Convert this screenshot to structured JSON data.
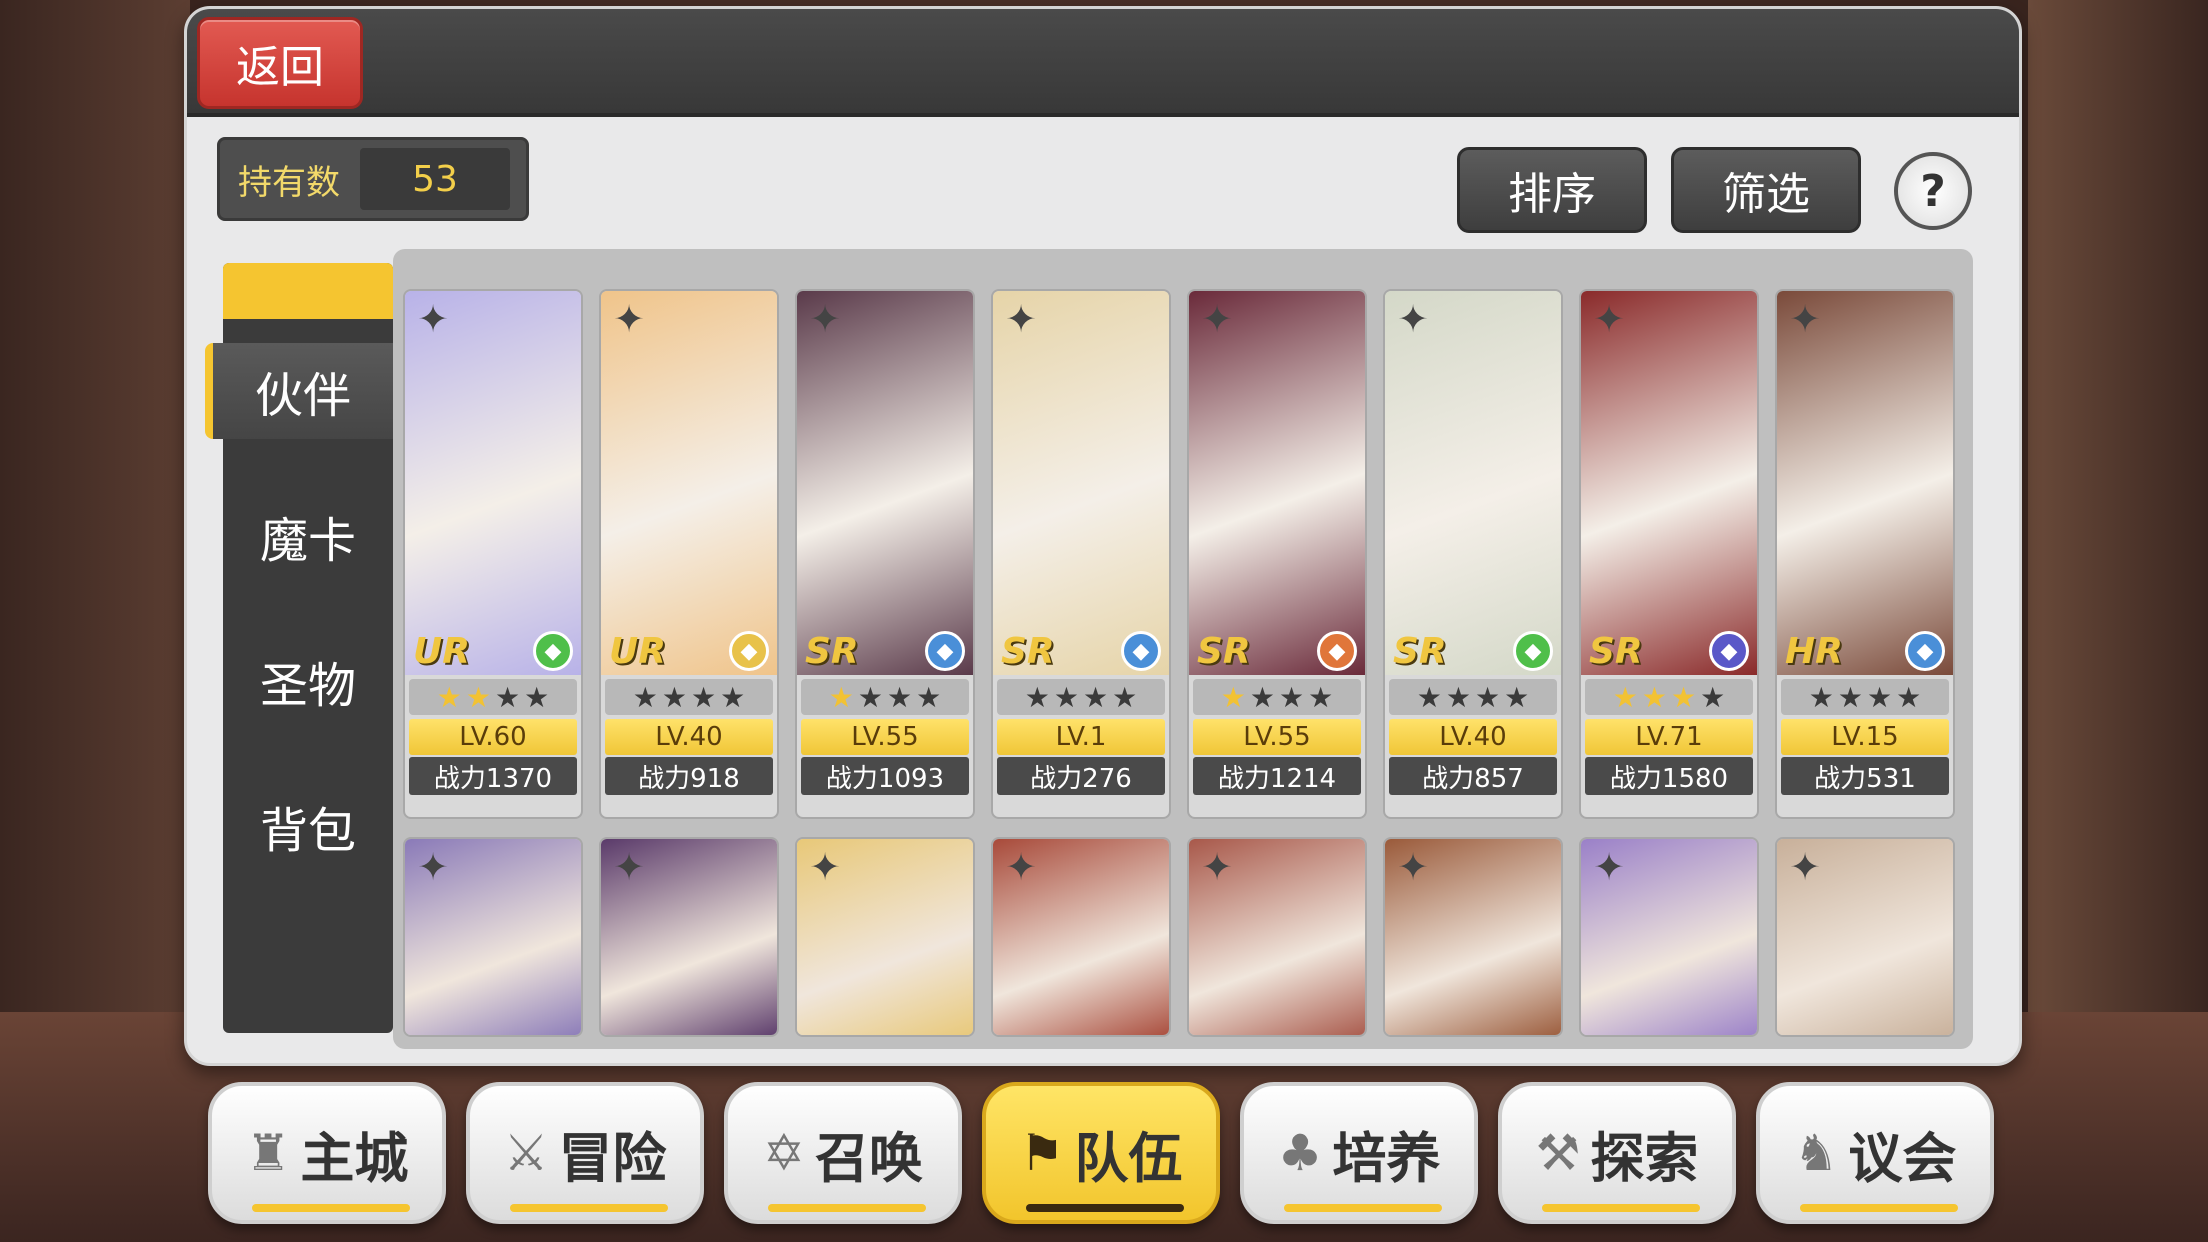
{
  "header": {
    "back_label": "返回"
  },
  "owned": {
    "label": "持有数",
    "value": "53"
  },
  "buttons": {
    "sort": "排序",
    "filter": "筛选",
    "help": "?"
  },
  "side_tabs": [
    {
      "label": "伙伴",
      "active": true
    },
    {
      "label": "魔卡",
      "active": false
    },
    {
      "label": "圣物",
      "active": false
    },
    {
      "label": "背包",
      "active": false
    }
  ],
  "cards_row1": [
    {
      "rarity": "UR",
      "stars": 2,
      "level": "LV.60",
      "power": "战力1370",
      "element_color": "#4fbf4a",
      "art_color": "#b8b2e8"
    },
    {
      "rarity": "UR",
      "stars": 0,
      "level": "LV.40",
      "power": "战力918",
      "element_color": "#e8c24a",
      "art_color": "#f0c48a"
    },
    {
      "rarity": "SR",
      "stars": 1,
      "level": "LV.55",
      "power": "战力1093",
      "element_color": "#4a8fd8",
      "art_color": "#5a3a4a"
    },
    {
      "rarity": "SR",
      "stars": 0,
      "level": "LV.1",
      "power": "战力276",
      "element_color": "#4a8fd8",
      "art_color": "#e6d4a8"
    },
    {
      "rarity": "SR",
      "stars": 1,
      "level": "LV.55",
      "power": "战力1214",
      "element_color": "#e0763a",
      "art_color": "#6a2a3a"
    },
    {
      "rarity": "SR",
      "stars": 0,
      "level": "LV.40",
      "power": "战力857",
      "element_color": "#4fbf4a",
      "art_color": "#d4d8c8"
    },
    {
      "rarity": "SR",
      "stars": 3,
      "level": "LV.71",
      "power": "战力1580",
      "element_color": "#5a58c8",
      "art_color": "#8a2a2a"
    },
    {
      "rarity": "HR",
      "stars": 0,
      "level": "LV.15",
      "power": "战力531",
      "element_color": "#4a8fd8",
      "art_color": "#7a4a3a"
    }
  ],
  "cards_row2": [
    {
      "art_color": "#8a7ab8"
    },
    {
      "art_color": "#5a3a6a"
    },
    {
      "art_color": "#e8c878"
    },
    {
      "art_color": "#a84a3a"
    },
    {
      "art_color": "#a8584a"
    },
    {
      "art_color": "#9a5a3a"
    },
    {
      "art_color": "#9a80c8"
    },
    {
      "art_color": "#c8b09a"
    }
  ],
  "bottom_nav": [
    {
      "label": "主城",
      "icon": "castle-icon",
      "glyph": "♜",
      "active": false
    },
    {
      "label": "冒险",
      "icon": "swords-icon",
      "glyph": "⚔",
      "active": false
    },
    {
      "label": "召唤",
      "icon": "hexagram-icon",
      "glyph": "✡",
      "active": false
    },
    {
      "label": "队伍",
      "icon": "team-icon",
      "glyph": "⚑",
      "active": true
    },
    {
      "label": "培养",
      "icon": "cultivate-icon",
      "glyph": "♣",
      "active": false
    },
    {
      "label": "探索",
      "icon": "explore-icon",
      "glyph": "⚒",
      "active": false
    },
    {
      "label": "议会",
      "icon": "council-icon",
      "glyph": "♞",
      "active": false
    }
  ]
}
